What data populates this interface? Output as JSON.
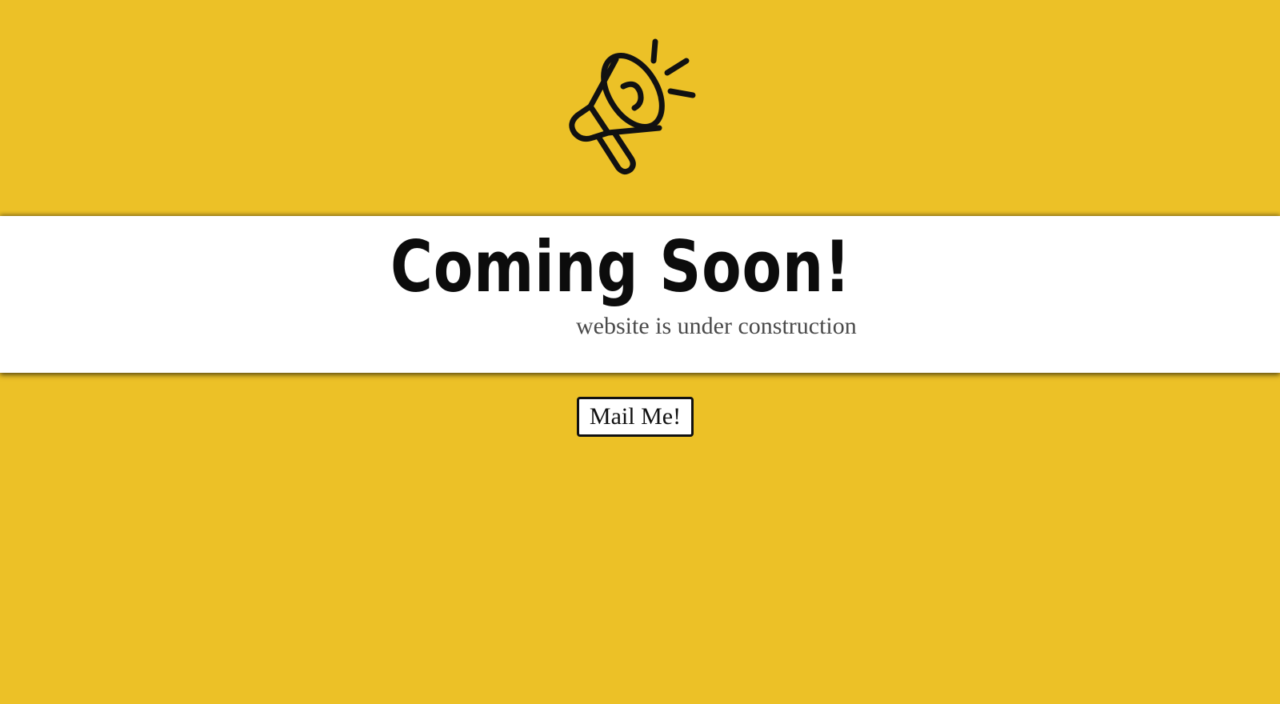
{
  "hero": {
    "icon": "megaphone-icon"
  },
  "banner": {
    "title": "Coming Soon!",
    "subtitle": "website is under construction"
  },
  "cta": {
    "label": "Mail Me!"
  },
  "colors": {
    "background": "#ecc127",
    "banner": "#ffffff",
    "text": "#0c0c0c",
    "subtitle": "#4a4a4a"
  }
}
